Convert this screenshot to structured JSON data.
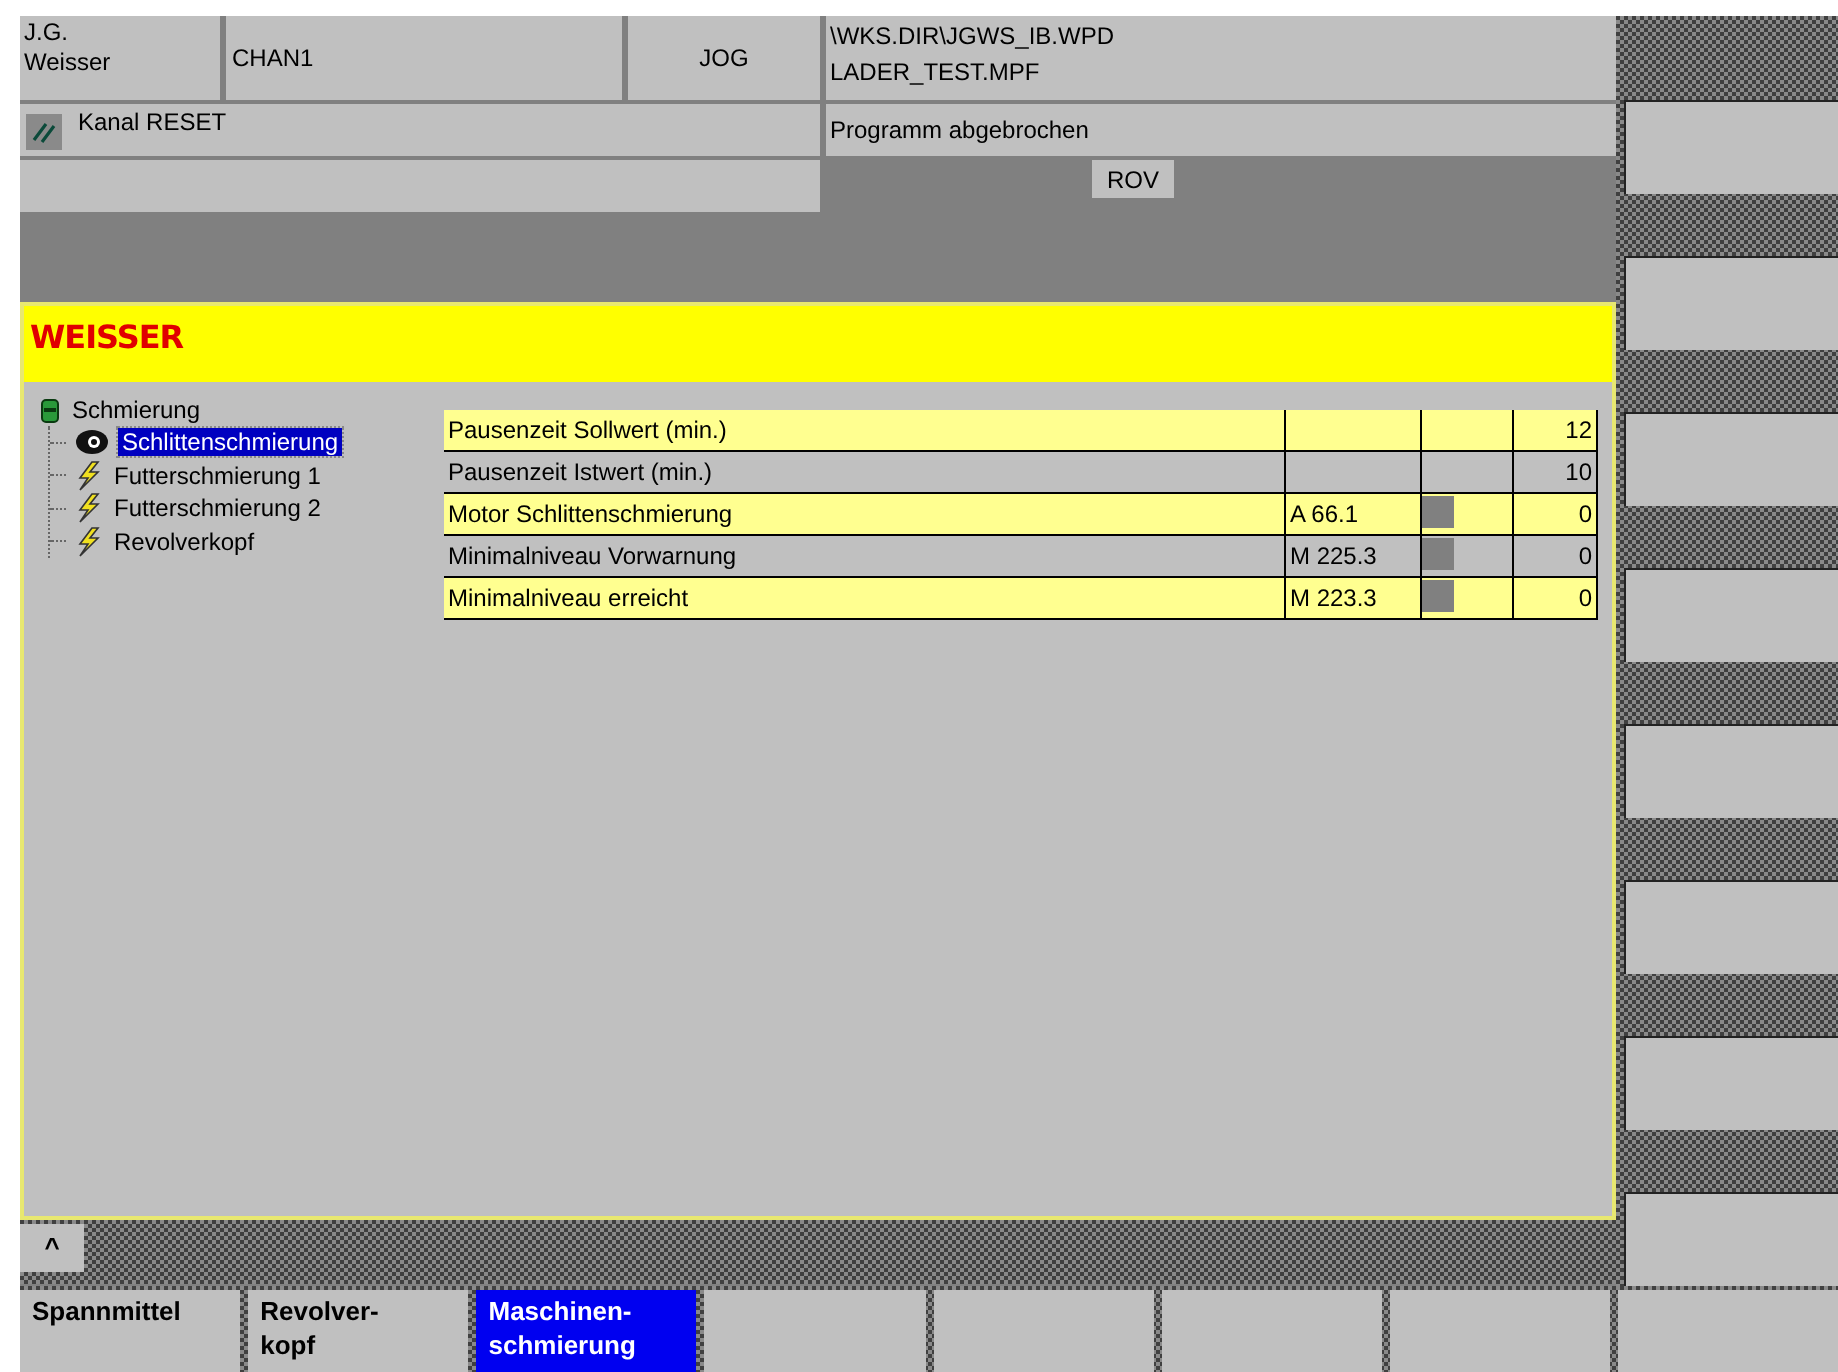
{
  "header": {
    "machine": "J.G.\nWeisser",
    "channel": "CHAN1",
    "mode": "JOG",
    "program_path": "\\WKS.DIR\\JGWS_IB.WPD",
    "program_file": "LADER_TEST.MPF",
    "channel_status": "Kanal RESET",
    "program_status": "Programm abgebrochen",
    "rov": "ROV"
  },
  "panel": {
    "title": "WEISSER",
    "tree": {
      "label": "Schmierung",
      "kind": "can",
      "children": [
        {
          "label": "Schlittenschmierung",
          "kind": "eye",
          "selected": true
        },
        {
          "label": "Futterschmierung 1",
          "kind": "lightning",
          "selected": false
        },
        {
          "label": "Futterschmierung 2",
          "kind": "lightning",
          "selected": false
        },
        {
          "label": "Revolverkopf",
          "kind": "lightning",
          "selected": false
        }
      ]
    },
    "table": {
      "rows": [
        {
          "label": "Pausenzeit Sollwert (min.)",
          "highlighted": true,
          "indicator": false,
          "value": "12"
        },
        {
          "label": "Pausenzeit Istwert (min.)",
          "highlighted": false,
          "indicator": false,
          "value": "10"
        },
        {
          "label": "Motor Schlittenschmierung",
          "address": "A 66.1",
          "highlighted": true,
          "indicator": true,
          "value": "0"
        },
        {
          "label": "Minimalniveau Vorwarnung",
          "address": "M 225.3",
          "highlighted": false,
          "indicator": true,
          "value": "0"
        },
        {
          "label": "Minimalniveau erreicht",
          "address": "M 223.3",
          "highlighted": true,
          "indicator": true,
          "value": "0"
        }
      ]
    }
  },
  "scroll_up": "^",
  "softkeys": [
    {
      "label": "Spannmittel",
      "selected": false
    },
    {
      "label": "Revolver-\nkopf",
      "selected": false
    },
    {
      "label": "Maschinen-\nschmierung",
      "selected": true
    },
    {
      "selected": false
    },
    {
      "selected": false
    },
    {
      "selected": false
    },
    {
      "selected": false
    },
    {
      "selected": false
    }
  ]
}
